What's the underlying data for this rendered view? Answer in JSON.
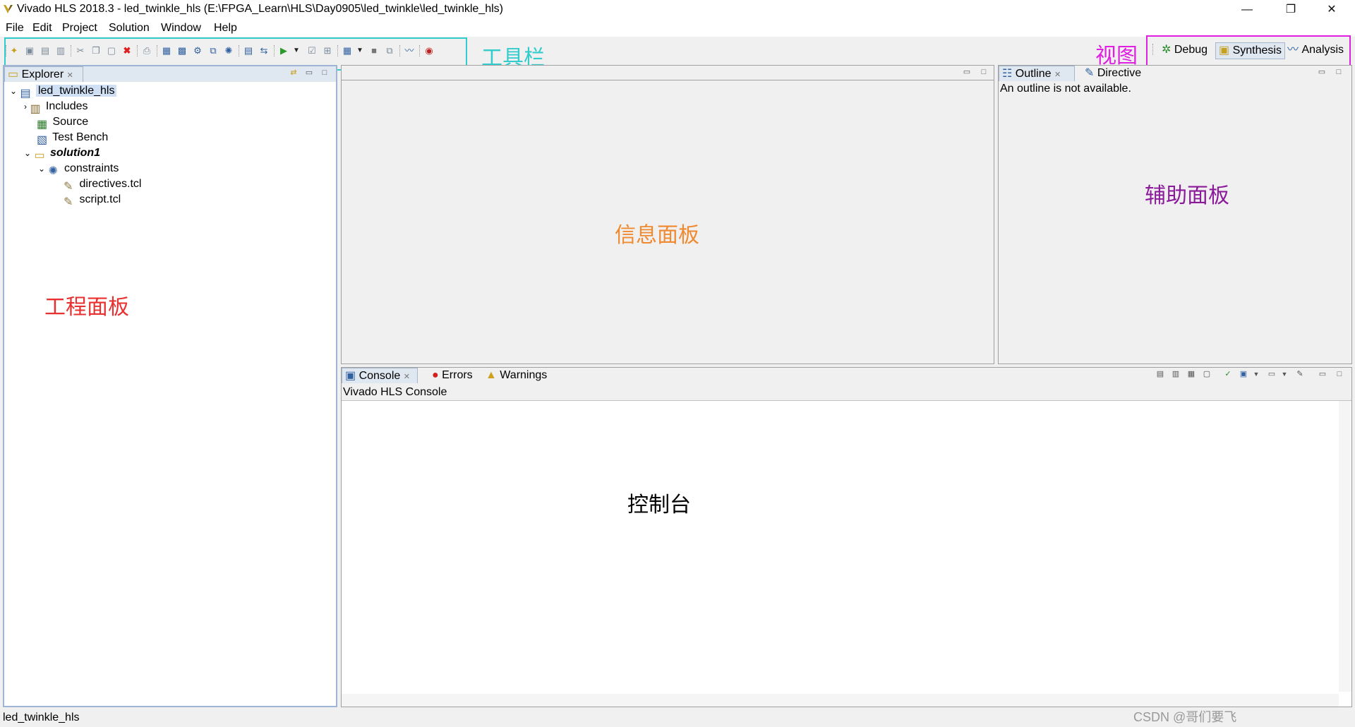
{
  "window": {
    "title": "Vivado HLS 2018.3 - led_twinkle_hls (E:\\FPGA_Learn\\HLS\\Day0905\\led_twinkle\\led_twinkle_hls)",
    "minimize": "—",
    "maximize": "❐",
    "close": "✕"
  },
  "menu": [
    "File",
    "Edit",
    "Project",
    "Solution",
    "Window",
    "Help"
  ],
  "annotations": {
    "toolbar": "工具栏",
    "perspective": "视图",
    "explorer": "工程面板",
    "info": "信息面板",
    "aux": "辅助面板",
    "console": "控制台",
    "toolbar_color": "#33cccc",
    "perspective_color": "#e020e0",
    "explorer_color": "#e83030",
    "info_color": "#f08a30",
    "aux_color": "#8a1a9a",
    "console_color": "#000000"
  },
  "perspectives": {
    "debug": "Debug",
    "synthesis": "Synthesis",
    "analysis": "Analysis"
  },
  "explorer": {
    "tab_label": "Explorer",
    "tree": {
      "project": "led_twinkle_hls",
      "includes": "Includes",
      "source": "Source",
      "test_bench": "Test Bench",
      "solution": "solution1",
      "constraints": "constraints",
      "directives": "directives.tcl",
      "script": "script.tcl"
    }
  },
  "outline": {
    "tab_outline": "Outline",
    "tab_directive": "Directive",
    "message": "An outline is not available."
  },
  "console": {
    "tab_console": "Console",
    "tab_errors": "Errors",
    "tab_warnings": "Warnings",
    "header": "Vivado HLS Console"
  },
  "status": {
    "left": "led_twinkle_hls",
    "watermark": "CSDN @哥们要飞"
  }
}
